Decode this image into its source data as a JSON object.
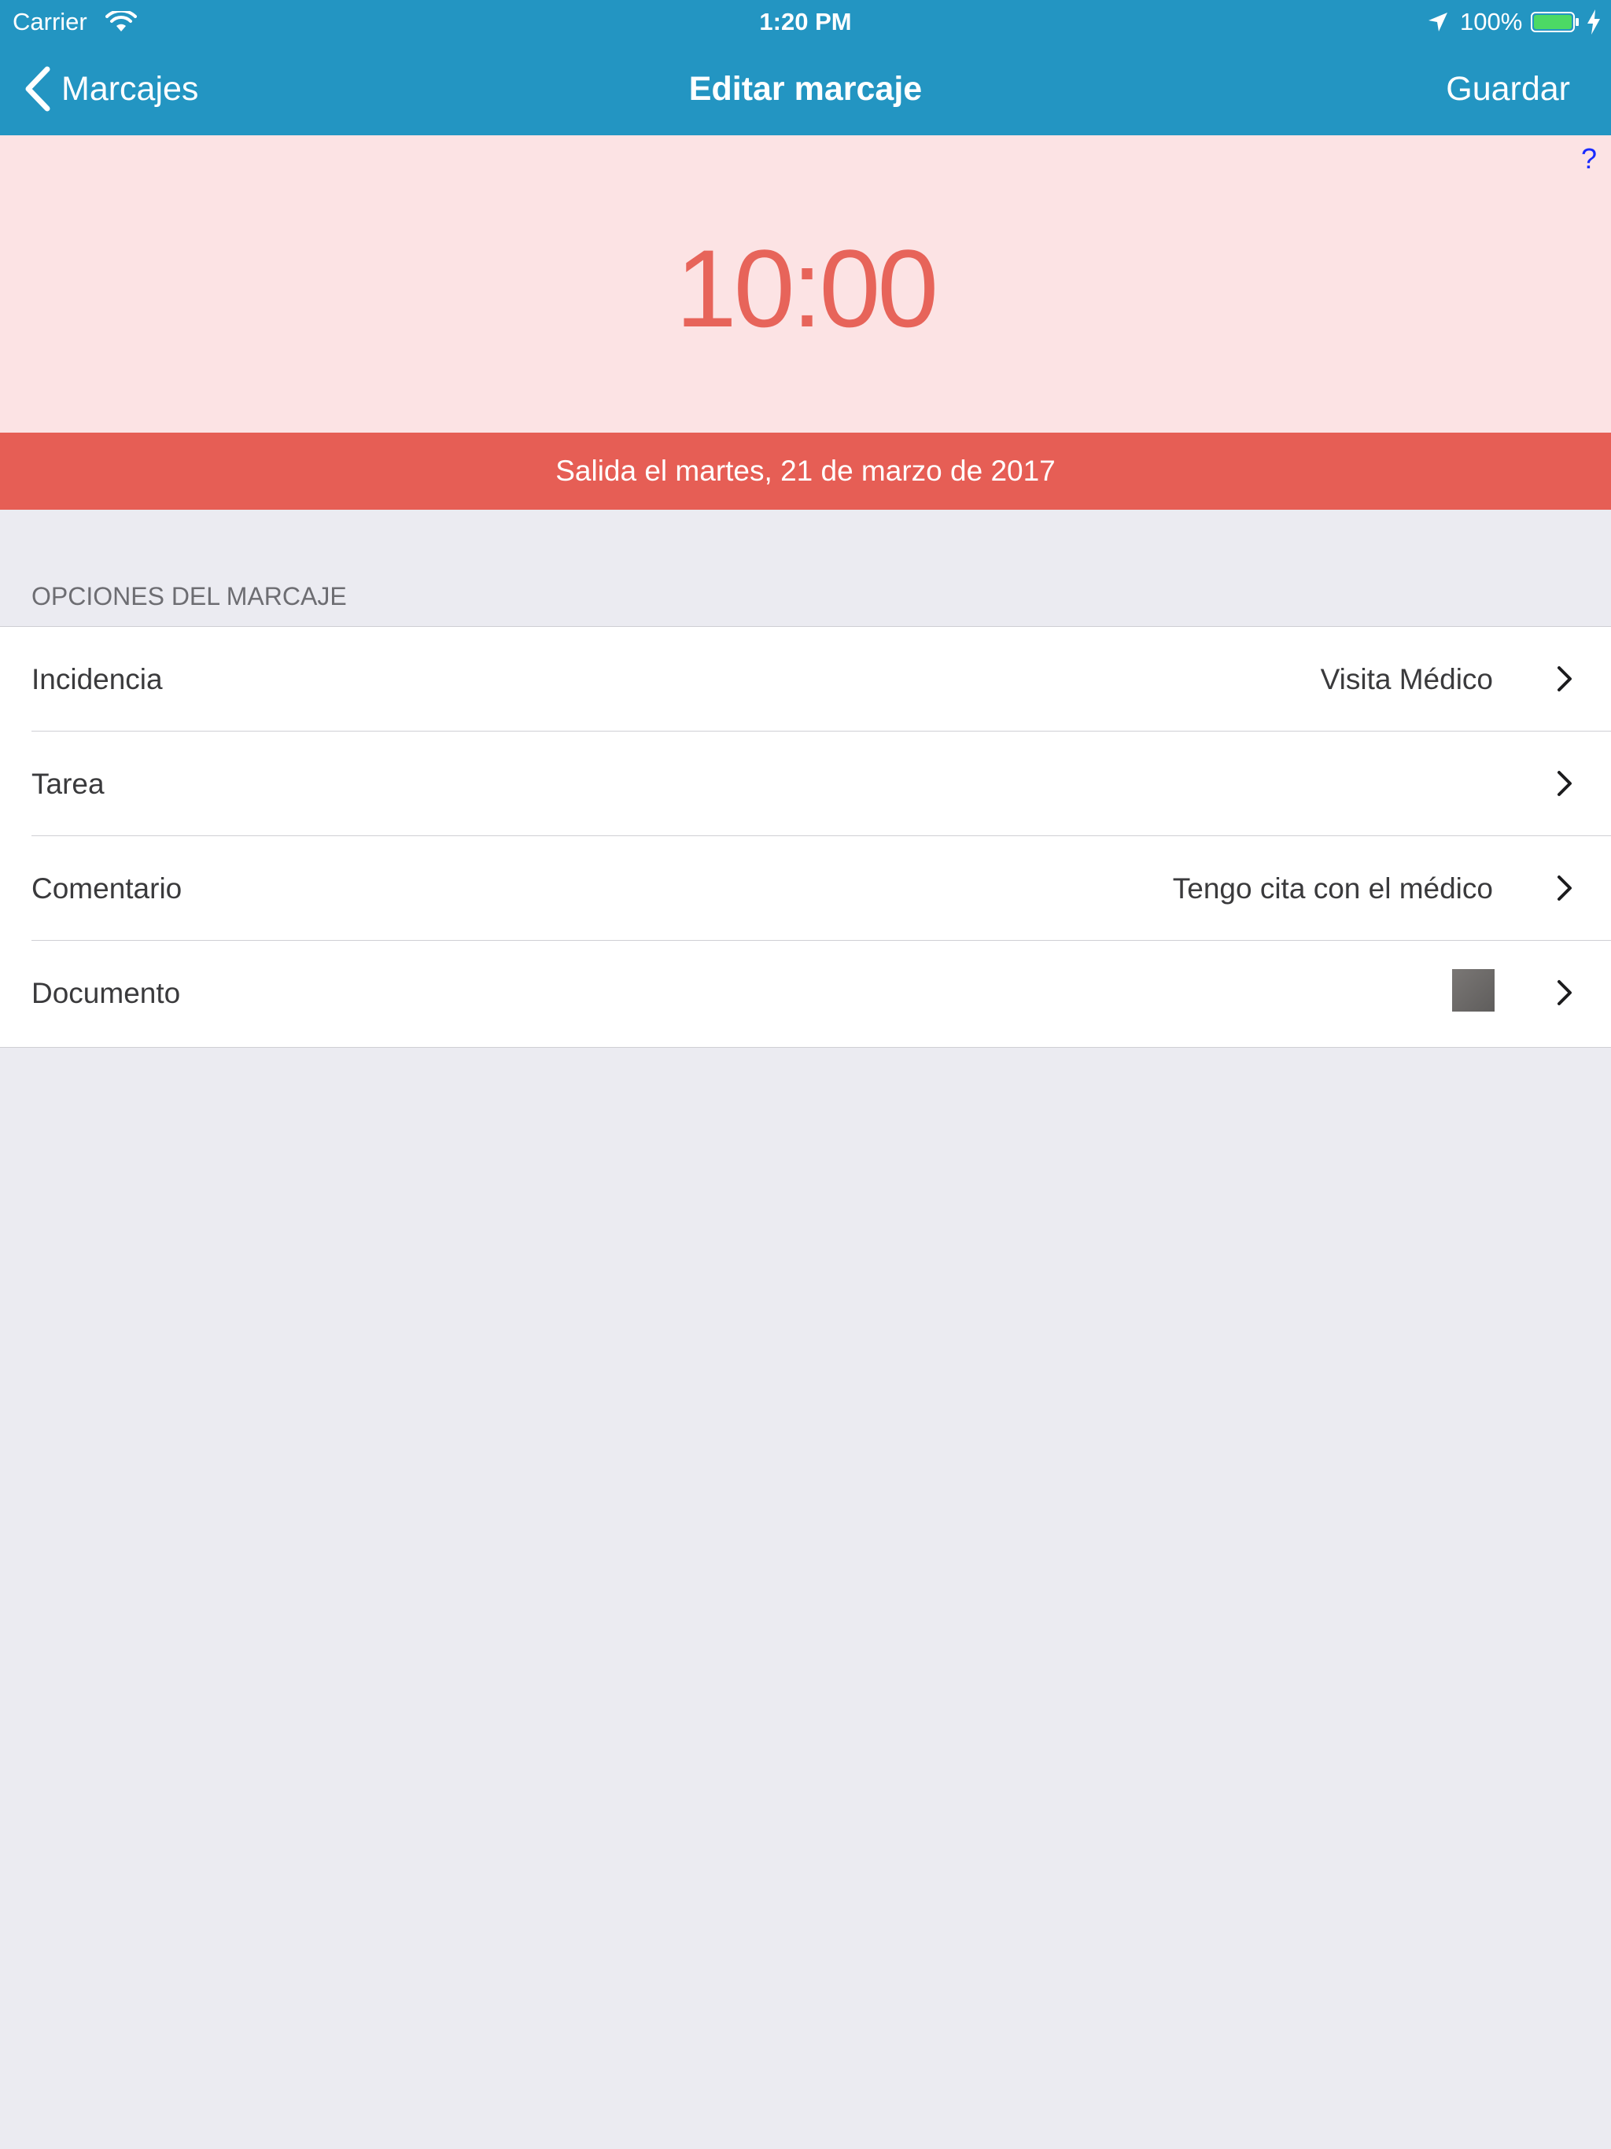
{
  "status_bar": {
    "carrier": "Carrier",
    "time": "1:20 PM",
    "battery_percent": "100%",
    "icons": [
      "wifi-icon",
      "location-arrow-icon",
      "battery-icon",
      "charging-bolt-icon"
    ]
  },
  "nav": {
    "back_label": "Marcajes",
    "title": "Editar marcaje",
    "save_label": "Guardar"
  },
  "hero": {
    "help_label": "?",
    "time": "10:00"
  },
  "banner": {
    "text": "Salida el martes, 21 de marzo de 2017"
  },
  "section": {
    "header": "OPCIONES DEL MARCAJE",
    "rows": [
      {
        "label": "Incidencia",
        "value": "Visita Médico"
      },
      {
        "label": "Tarea",
        "value": ""
      },
      {
        "label": "Comentario",
        "value": "Tengo cita con el médico"
      },
      {
        "label": "Documento",
        "value": ""
      }
    ]
  },
  "colors": {
    "nav_bar": "#2395c2",
    "hero_bg": "#fce3e4",
    "accent_red": "#e65e55",
    "page_bg": "#ebebf1"
  }
}
